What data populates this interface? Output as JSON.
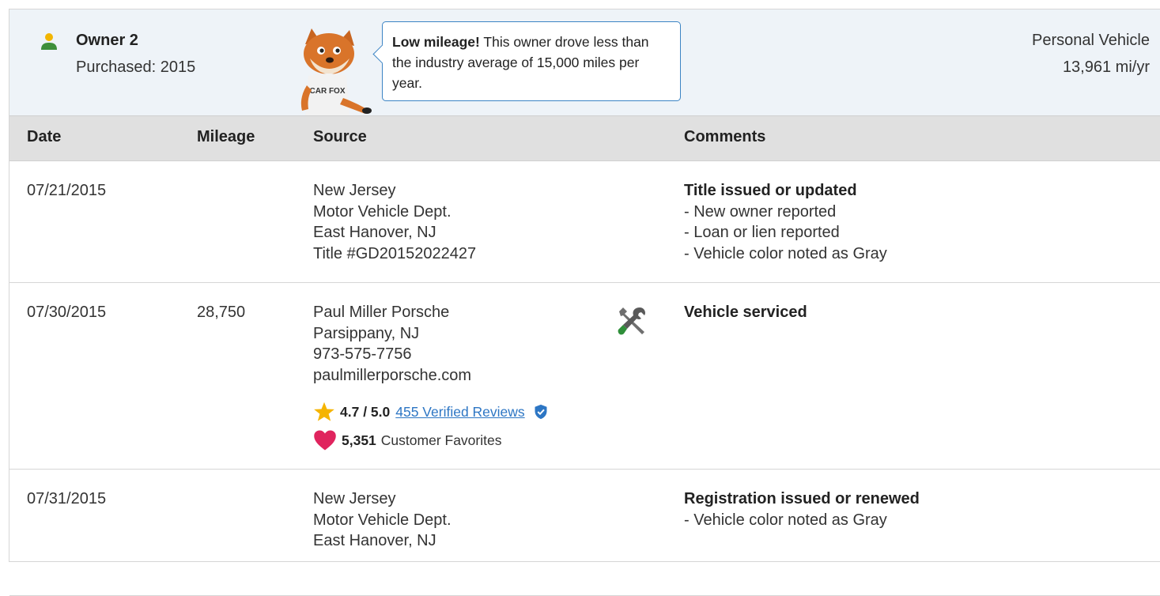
{
  "owner": {
    "name": "Owner 2",
    "purchased": "Purchased: 2015",
    "vehicle_type": "Personal Vehicle",
    "miles_per_year": "13,961 mi/yr",
    "fox_shirt_text": "CAR FOX",
    "callout": {
      "bold": "Low mileage!",
      "text": " This owner drove less than the industry average of 15,000 miles per year."
    }
  },
  "table": {
    "headers": {
      "date": "Date",
      "mileage": "Mileage",
      "source": "Source",
      "comments": "Comments"
    },
    "rows": [
      {
        "date": "07/21/2015",
        "mileage": "",
        "source": [
          "New Jersey",
          "Motor Vehicle Dept.",
          "East Hanover, NJ",
          "Title #GD20152022427"
        ],
        "comment_title": "Title issued or updated",
        "comment_items": [
          "- New owner reported",
          "- Loan or lien reported",
          "- Vehicle color noted as Gray"
        ]
      },
      {
        "date": "07/30/2015",
        "mileage": "28,750",
        "source": [
          "Paul Miller Porsche",
          "Parsippany, NJ",
          "973-575-7756",
          "paulmillerporsche.com"
        ],
        "rating": "4.7 / 5.0",
        "reviews": "455 Verified Reviews",
        "favorites_count": "5,351",
        "favorites_label": "Customer Favorites",
        "icon": "service-tools-icon",
        "comment_title": "Vehicle serviced",
        "comment_items": []
      },
      {
        "date": "07/31/2015",
        "mileage": "",
        "source": [
          "New Jersey",
          "Motor Vehicle Dept.",
          "East Hanover, NJ"
        ],
        "comment_title": "Registration issued or renewed",
        "comment_items": [
          "- Vehicle color noted as Gray"
        ]
      }
    ]
  },
  "colors": {
    "header_bg": "#eef3f8",
    "table_header_bg": "#e0e0e0",
    "link": "#2d76c4",
    "owner_icon": "#3e8f3a",
    "star": "#f5b400",
    "heart": "#e0245e",
    "callout_border": "#3c84c4"
  }
}
